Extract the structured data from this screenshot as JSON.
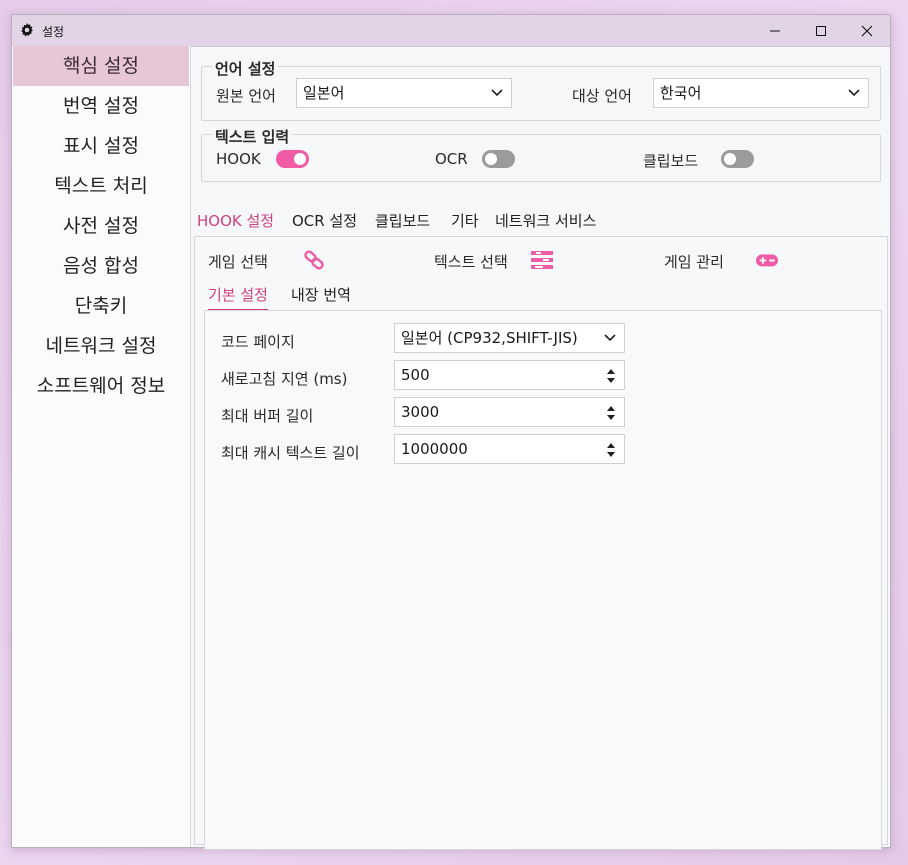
{
  "window": {
    "title": "설정",
    "icons": {
      "app": "gear-icon",
      "minimize": "minimize-icon",
      "maximize": "maximize-icon",
      "close": "close-icon"
    }
  },
  "sidebar": {
    "items": [
      {
        "label": "핵심 설정",
        "active": true
      },
      {
        "label": "번역 설정"
      },
      {
        "label": "표시 설정"
      },
      {
        "label": "텍스트 처리"
      },
      {
        "label": "사전 설정"
      },
      {
        "label": "음성 합성"
      },
      {
        "label": "단축키"
      },
      {
        "label": "네트워크 설정"
      },
      {
        "label": "소프트웨어 정보"
      }
    ]
  },
  "language": {
    "title": "언어 설정",
    "source_label": "원본 언어",
    "source_value": "일본어",
    "target_label": "대상 언어",
    "target_value": "한국어"
  },
  "text_input": {
    "title": "텍스트 입력",
    "hook_label": "HOOK",
    "hook_on": true,
    "ocr_label": "OCR",
    "ocr_on": false,
    "clipboard_label": "클립보드",
    "clipboard_on": false
  },
  "tabs": [
    "HOOK 설정",
    "OCR 설정",
    "클립보드",
    "기타",
    "네트워크 서비스"
  ],
  "hook_panel": {
    "game_select": "게임 선택",
    "text_select": "텍스트 선택",
    "game_manage": "게임 관리",
    "subtabs": [
      "기본 설정",
      "내장 번역"
    ],
    "settings": [
      {
        "label": "코드 페이지",
        "value": "일본어 (CP932,SHIFT-JIS)"
      },
      {
        "label": "새로고침 지연 (ms)",
        "value": "500"
      },
      {
        "label": "최대 버퍼 길이",
        "value": "3000"
      },
      {
        "label": "최대 캐시 텍스트 길이",
        "value": "1000000"
      }
    ]
  },
  "colors": {
    "accent": "#f05ba6",
    "accent_text": "#d0417f",
    "active_sidebar": "#e6c6d7",
    "titlebar": "#e3d3e6"
  }
}
